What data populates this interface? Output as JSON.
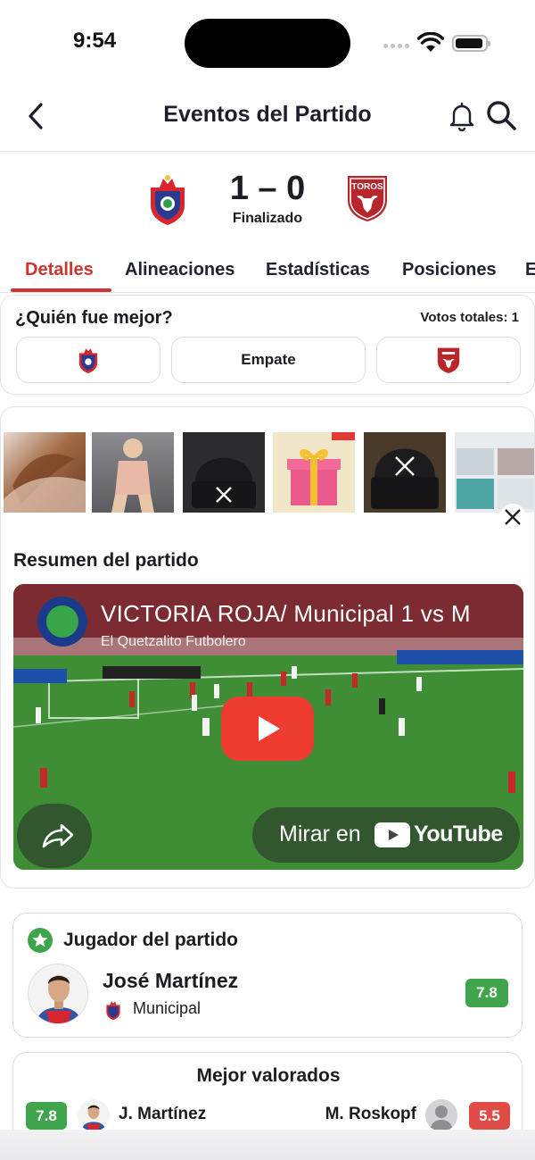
{
  "status_bar": {
    "time": "9:54"
  },
  "header": {
    "title": "Eventos del Partido"
  },
  "match": {
    "home_team": "Municipal",
    "away_team": "Toros",
    "away_crest_text": "TOROS",
    "score": "1 – 0",
    "status": "Finalizado"
  },
  "tabs": [
    {
      "label": "Detalles"
    },
    {
      "label": "Alineaciones"
    },
    {
      "label": "Estadísticas"
    },
    {
      "label": "Posiciones"
    },
    {
      "label": "E"
    }
  ],
  "vote": {
    "title": "¿Quién fue mejor?",
    "total": "Votos totales: 1",
    "draw_label": "Empate"
  },
  "summary": {
    "title": "Resumen del partido",
    "video_title": "VICTORIA ROJA/ Municipal 1 vs M",
    "channel": "El Quetzalito Futbolero",
    "watch_on": "Mirar en",
    "youtube": "YouTube"
  },
  "player_of_match": {
    "title": "Jugador del partido",
    "name": "José Martínez",
    "team": "Municipal",
    "rating": "7.8"
  },
  "top_rated": {
    "title": "Mejor valorados",
    "left": {
      "name": "J. Martínez",
      "rating": "7.8"
    },
    "right": {
      "name": "M. Roskopf",
      "rating": "5.5"
    }
  },
  "colors": {
    "accent": "#d0342c",
    "rating_good": "#3fa54c",
    "rating_bad": "#df4b45",
    "pitch": "#3c8a34"
  }
}
